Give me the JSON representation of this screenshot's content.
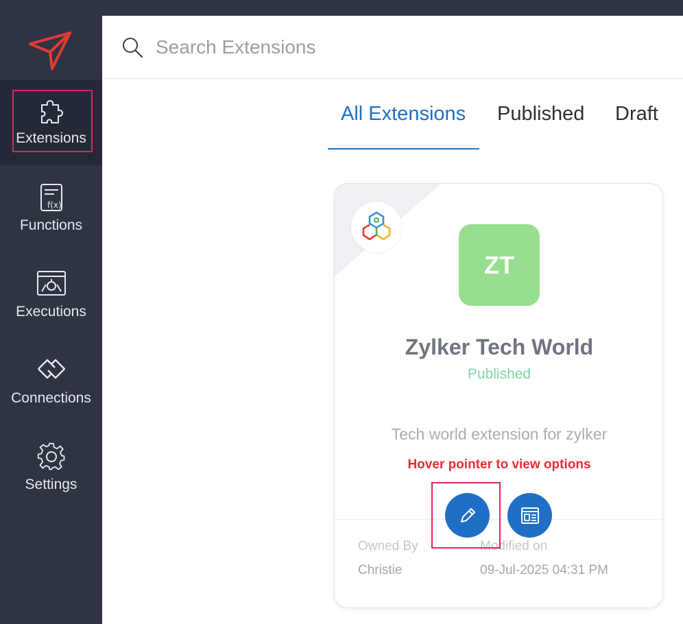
{
  "search": {
    "placeholder": "Search Extensions"
  },
  "sidebar": {
    "items": [
      {
        "label": "Extensions",
        "icon": "puzzle-icon",
        "active": true
      },
      {
        "label": "Functions",
        "icon": "function-icon",
        "active": false
      },
      {
        "label": "Executions",
        "icon": "executions-icon",
        "active": false
      },
      {
        "label": "Connections",
        "icon": "connections-icon",
        "active": false
      },
      {
        "label": "Settings",
        "icon": "gear-icon",
        "active": false
      }
    ]
  },
  "tabs": [
    {
      "label": "All Extensions",
      "active": true
    },
    {
      "label": "Published",
      "active": false
    },
    {
      "label": "Draft",
      "active": false
    }
  ],
  "card": {
    "initials": "ZT",
    "name": "Zylker Tech World",
    "status": "Published",
    "description": "Tech world extension for zylker",
    "hint": "Hover pointer to view options",
    "owned_by_label": "Owned By",
    "owner": "Christie",
    "modified_label": "Modified on",
    "modified": "09-Jul-2025 04:31 PM",
    "actions": [
      {
        "icon": "pencil-icon",
        "name": "edit"
      },
      {
        "icon": "preview-icon",
        "name": "view"
      }
    ]
  },
  "colors": {
    "sidebar": "#2e3442",
    "accent": "#1e6fc5",
    "highlight": "#e0245e",
    "avatar": "#98de90",
    "status": "#7fd3a3",
    "hint": "#ee2b35"
  }
}
